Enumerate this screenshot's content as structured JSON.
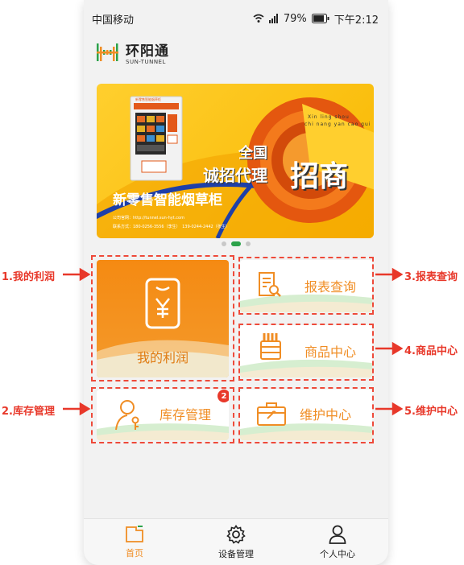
{
  "status": {
    "carrier": "中国移动",
    "battery": "79%",
    "time": "下午2:12"
  },
  "brand": {
    "name_cn": "环阳通",
    "name_en": "SUN-TUNNEL"
  },
  "banner": {
    "headline": "新零售智能烟草柜",
    "slogan_top": "全国",
    "slogan_main": "诚招代理",
    "slogan_big": "招商",
    "pinyin1": "Xin ling shou",
    "pinyin2": "chi nang yan cao gui",
    "website": "公司官网：http://tunnel.sun-hyt.com",
    "contact": "联系方式：180-0256-3556（李生）　139-0244-2442（张生）",
    "cabinet_label": "新零售智能烟草柜"
  },
  "tiles": {
    "profit": "我的利润",
    "report": "报表查询",
    "goods": "商品中心",
    "inventory": "库存管理",
    "maintenance": "维护中心",
    "inventory_badge": "2"
  },
  "annotations": {
    "a1": "1.我的利润",
    "a2": "2.库存管理",
    "a3": "3.报表查询",
    "a4": "4.商品中心",
    "a5": "5.维护中心"
  },
  "tabs": [
    {
      "label": "首页",
      "icon": "home-icon"
    },
    {
      "label": "设备管理",
      "icon": "gear-icon"
    },
    {
      "label": "个人中心",
      "icon": "person-icon"
    }
  ],
  "colors": {
    "accent": "#f08d24",
    "annotation": "#e8382a",
    "wave": "#bfe3b8",
    "active_dot": "#2ca24a"
  }
}
